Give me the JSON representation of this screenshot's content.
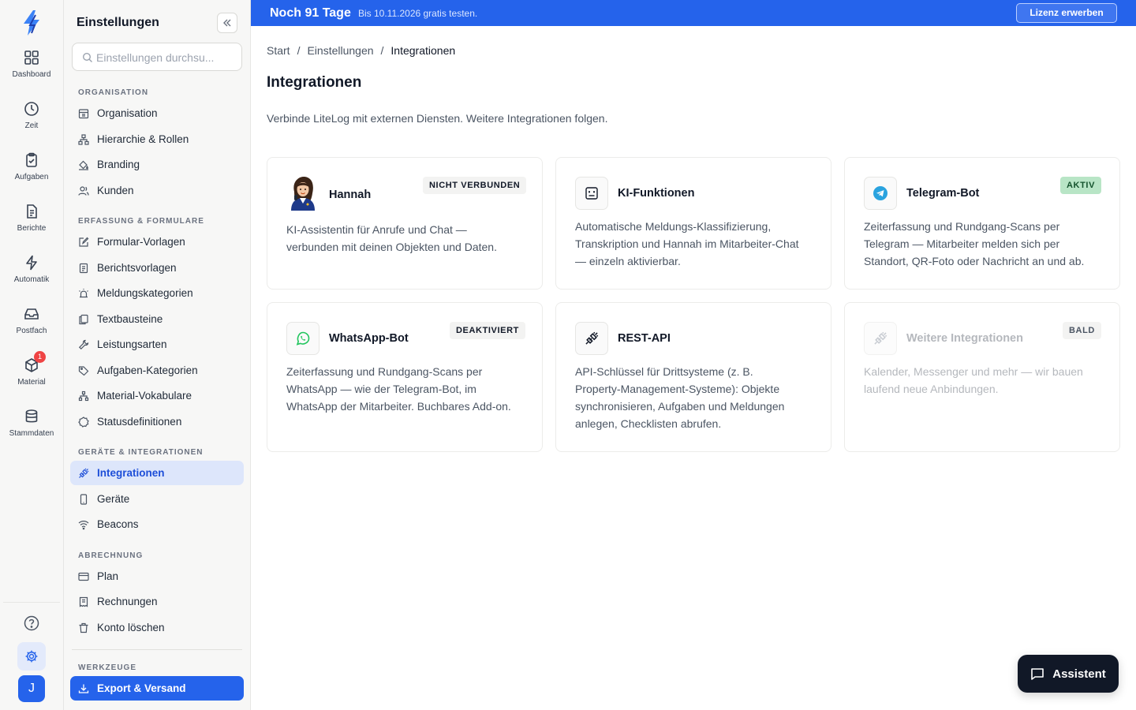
{
  "rail": {
    "items": [
      {
        "label": "Dashboard",
        "icon": "dashboard-icon"
      },
      {
        "label": "Zeit",
        "icon": "clock-icon"
      },
      {
        "label": "Aufgaben",
        "icon": "clipboard-check-icon"
      },
      {
        "label": "Berichte",
        "icon": "document-icon"
      },
      {
        "label": "Automatik",
        "icon": "bolt-icon"
      },
      {
        "label": "Postfach",
        "icon": "inbox-icon"
      },
      {
        "label": "Material",
        "icon": "package-icon",
        "badge": "1"
      },
      {
        "label": "Stammdaten",
        "icon": "database-icon"
      }
    ],
    "avatar": "J"
  },
  "sidebar": {
    "title": "Einstellungen",
    "search_placeholder": "Einstellungen durchsu...",
    "sections": [
      {
        "title": "ORGANISATION",
        "items": [
          {
            "label": "Organisation",
            "icon": "building-icon"
          },
          {
            "label": "Hierarchie & Rollen",
            "icon": "hierarchy-icon"
          },
          {
            "label": "Branding",
            "icon": "paint-bucket-icon"
          },
          {
            "label": "Kunden",
            "icon": "users-icon"
          }
        ]
      },
      {
        "title": "ERFASSUNG & FORMULARE",
        "items": [
          {
            "label": "Formular-Vorlagen",
            "icon": "edit-form-icon"
          },
          {
            "label": "Berichtsvorlagen",
            "icon": "report-template-icon"
          },
          {
            "label": "Meldungskategorien",
            "icon": "siren-icon"
          },
          {
            "label": "Textbausteine",
            "icon": "copy-icon"
          },
          {
            "label": "Leistungsarten",
            "icon": "wrench-icon"
          },
          {
            "label": "Aufgaben-Kategorien",
            "icon": "tag-icon"
          },
          {
            "label": "Material-Vokabulare",
            "icon": "network-icon"
          },
          {
            "label": "Statusdefinitionen",
            "icon": "status-badge-icon"
          }
        ]
      },
      {
        "title": "GERÄTE & INTEGRATIONEN",
        "items": [
          {
            "label": "Integrationen",
            "icon": "plug-icon",
            "active": true
          },
          {
            "label": "Geräte",
            "icon": "smartphone-icon"
          },
          {
            "label": "Beacons",
            "icon": "wifi-icon"
          }
        ]
      },
      {
        "title": "ABRECHNUNG",
        "items": [
          {
            "label": "Plan",
            "icon": "credit-card-icon"
          },
          {
            "label": "Rechnungen",
            "icon": "receipt-icon"
          },
          {
            "label": "Konto löschen",
            "icon": "trash-icon"
          }
        ]
      },
      {
        "title": "WERKZEUGE",
        "items": [
          {
            "label": "Export & Versand",
            "icon": "download-icon",
            "primary": true
          }
        ]
      }
    ]
  },
  "banner": {
    "title": "Noch 91 Tage",
    "subtitle": "Bis 10.11.2026 gratis testen.",
    "button": "Lizenz erwerben"
  },
  "breadcrumb": [
    "Start",
    "Einstellungen",
    "Integrationen"
  ],
  "page": {
    "title": "Integrationen",
    "description": "Verbinde LiteLog mit externen Diensten. Weitere Integrationen folgen."
  },
  "cards": [
    {
      "title": "Hannah",
      "badge": "NICHT VERBUNDEN",
      "icon": "avatar-hannah-icon",
      "text": [
        "KI-Assistentin für Anrufe und Chat —",
        "verbunden mit deinen Objekten und Daten."
      ]
    },
    {
      "title": "KI-Funktionen",
      "badge": "",
      "icon": "robot-icon",
      "text": [
        "Automatische Meldungs-Klassifizierung,",
        "Transkription und Hannah im Mitarbeiter-Chat",
        "— einzeln aktivierbar."
      ]
    },
    {
      "title": "Telegram-Bot",
      "badge": "AKTIV",
      "icon": "telegram-icon",
      "text": [
        "Zeiterfassung und Rundgang-Scans per",
        "Telegram — Mitarbeiter melden sich per",
        "Standort, QR-Foto oder Nachricht an und ab."
      ]
    },
    {
      "title": "WhatsApp-Bot",
      "badge": "DEAKTIVIERT",
      "icon": "whatsapp-icon",
      "text": [
        "Zeiterfassung und Rundgang-Scans per",
        "WhatsApp — wie der Telegram-Bot, im",
        "WhatsApp der Mitarbeiter. Buchbares Add-on."
      ]
    },
    {
      "title": "REST-API",
      "badge": "",
      "icon": "plug-icon",
      "text": [
        "API-Schlüssel für Drittsysteme (z. B.",
        "Property-Management-Systeme): Objekte",
        "synchronisieren, Aufgaben und Meldungen",
        "anlegen, Checklisten abrufen."
      ]
    },
    {
      "title": "Weitere Integrationen",
      "badge": "BALD",
      "icon": "plug-icon",
      "text": [
        "Kalender, Messenger und mehr — wir bauen",
        "laufend neue Anbindungen."
      ]
    }
  ],
  "assistant": {
    "label": "Assistent",
    "icon": "chat-bubble-icon"
  },
  "colors": {
    "accent": "#2563eb",
    "active_bg": "#dde6fb",
    "badge_active_bg": "#b8e5c6",
    "badge_neutral_bg": "#f3f3f2",
    "badge_red": "#ef4444"
  }
}
